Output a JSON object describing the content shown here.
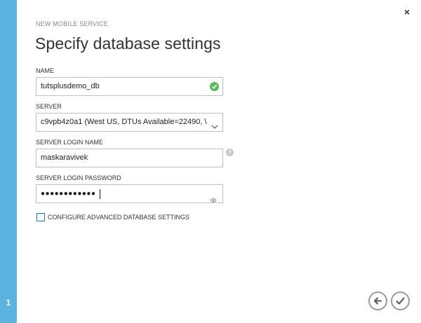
{
  "wizard": {
    "step_number": "1",
    "eyebrow": "NEW MOBILE SERVICE",
    "title": "Specify database settings",
    "close_glyph": "×"
  },
  "form": {
    "name_label": "NAME",
    "name_value": "tutsplusdemo_db",
    "server_label": "SERVER",
    "server_value": "c9vpb4z0a1 (West US, DTUs Available=22490, \\",
    "login_label": "SERVER LOGIN NAME",
    "login_value": "maskaravivek",
    "help_glyph": "?",
    "password_label": "SERVER LOGIN PASSWORD",
    "password_mask": "●●●●●●●●●●●●",
    "advanced_label": "CONFIGURE ADVANCED DATABASE SETTINGS",
    "advanced_checked": false
  },
  "icons": {
    "valid": "check-circle-icon",
    "dropdown": "chevron-down-icon",
    "help": "help-icon",
    "reveal": "eye-icon",
    "back": "arrow-left-icon",
    "complete": "checkmark-icon"
  },
  "colors": {
    "sidebar": "#5bb4e0",
    "valid": "#5cb85c",
    "checkbox_border": "#1e7bc3"
  }
}
